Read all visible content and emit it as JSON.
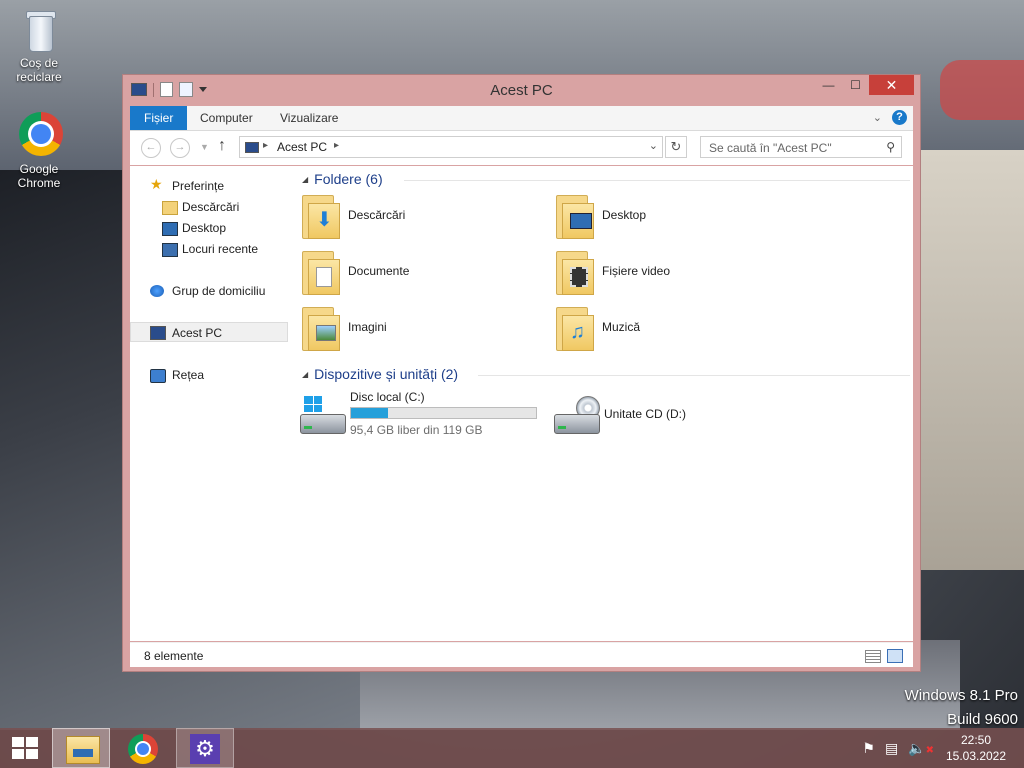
{
  "desktop": {
    "icons": [
      {
        "label": "Coş de reciclare"
      },
      {
        "label": "Google Chrome"
      }
    ],
    "watermark": {
      "line1": "Windows 8.1 Pro",
      "line2": "Build 9600"
    }
  },
  "window": {
    "title": "Acest PC",
    "controls": {
      "minimize": "—",
      "maximize": "☐",
      "close": "✕"
    },
    "ribbon": {
      "tabs": [
        "Fișier",
        "Computer",
        "Vizualizare"
      ],
      "help": "?"
    },
    "address": {
      "path": "Acest PC",
      "search_placeholder": "Se caută în \"Acest PC\""
    },
    "nav": {
      "items": [
        {
          "label": "Preferințe",
          "icon": "star-icon"
        },
        {
          "label": "Descărcări",
          "icon": "folder-icon"
        },
        {
          "label": "Desktop",
          "icon": "desktop-icon"
        },
        {
          "label": "Locuri recente",
          "icon": "recent-places-icon"
        },
        {
          "label": "Grup de domiciliu",
          "icon": "homegroup-icon"
        },
        {
          "label": "Acest PC",
          "icon": "computer-icon",
          "selected": true
        },
        {
          "label": "Rețea",
          "icon": "network-icon"
        }
      ]
    },
    "groups": {
      "folders": {
        "title": "Foldere (6)",
        "items": [
          {
            "label": "Descărcări",
            "icon": "downloads-folder-icon"
          },
          {
            "label": "Desktop",
            "icon": "desktop-folder-icon"
          },
          {
            "label": "Documente",
            "icon": "documents-folder-icon"
          },
          {
            "label": "Fișiere video",
            "icon": "videos-folder-icon"
          },
          {
            "label": "Imagini",
            "icon": "pictures-folder-icon"
          },
          {
            "label": "Muzică",
            "icon": "music-folder-icon"
          }
        ]
      },
      "devices": {
        "title": "Dispozitive și unități (2)",
        "items": [
          {
            "label": "Disc local (C:)",
            "free": "95,4 GB liber din 119 GB",
            "used_fraction": 0.2,
            "icon": "local-disk-icon"
          },
          {
            "label": "Unitate CD (D:)",
            "icon": "cd-drive-icon"
          }
        ]
      }
    },
    "status": {
      "count": "8 elemente"
    }
  },
  "taskbar": {
    "apps": [
      "File Explorer",
      "Google Chrome",
      "Settings"
    ],
    "clock": {
      "time": "22:50",
      "date": "15.03.2022"
    }
  },
  "colors": {
    "accent": "#1979ca",
    "window_frame": "#d9a3a3",
    "close": "#c7403a",
    "drive_fill": "#26a0da"
  }
}
